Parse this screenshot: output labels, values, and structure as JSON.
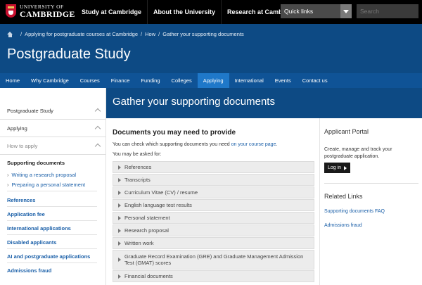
{
  "header": {
    "logo_line1": "UNIVERSITY OF",
    "logo_line2": "CAMBRIDGE",
    "nav": [
      "Study at Cambridge",
      "About the University",
      "Research at Cambridge"
    ],
    "quick_links": "Quick links",
    "search_placeholder": "Search"
  },
  "breadcrumb": [
    "Applying for postgraduate courses at Cambridge",
    "How",
    "Gather your supporting documents"
  ],
  "page_title": "Postgraduate Study",
  "main_nav": {
    "items": [
      "Home",
      "Why Cambridge",
      "Courses",
      "Finance",
      "Funding",
      "Colleges",
      "Applying",
      "International",
      "Events",
      "Contact us"
    ],
    "active": "Applying"
  },
  "sidebar": {
    "sections": [
      "Postgraduate Study",
      "Applying",
      "How to apply"
    ],
    "current": "Supporting documents",
    "sub_items": [
      "Writing a research proposal",
      "Preparing a personal statement"
    ],
    "links": [
      "References",
      "Application fee",
      "International applications",
      "Disabled applicants",
      "AI and postgraduate applications",
      "Admissions fraud"
    ]
  },
  "content": {
    "title": "Gather your supporting documents",
    "section_title": "Documents you may need to provide",
    "para1_before": "You can check which supporting documents you need ",
    "para1_link": "on your course page",
    "para1_after": ".",
    "para2": "You may be asked for:",
    "accordion": [
      "References",
      "Transcripts",
      "Curriculum Vitae (CV) / resume",
      "English language test results",
      "Personal statement",
      "Research proposal",
      "Written work",
      "Graduate Record Examination (GRE) and Graduate Management Admission Test (GMAT) scores",
      "Financial documents"
    ]
  },
  "aside": {
    "portal_title": "Applicant Portal",
    "portal_text": "Create, manage and track your postgraduate application.",
    "login_label": "Log in",
    "related_title": "Related Links",
    "related_links": [
      "Supporting documents FAQ",
      "Admissions fraud"
    ]
  }
}
